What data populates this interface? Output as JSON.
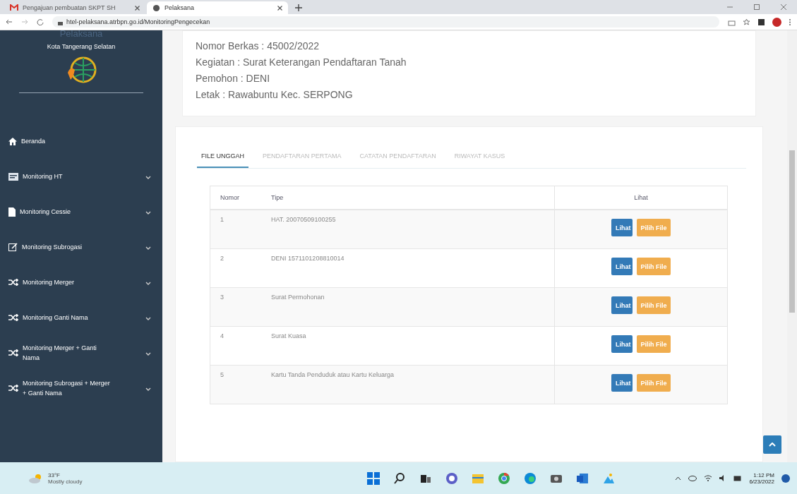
{
  "browser": {
    "tabs": [
      {
        "title": "Pengajuan pembuatan SKPT SH",
        "selected": false
      },
      {
        "title": "Pelaksana",
        "selected": true
      }
    ],
    "url": "htel-pelaksana.atrbpn.go.id/MonitoringPengecekan"
  },
  "sidebar": {
    "title": "Pelaksana",
    "subtitle": "Kota Tangerang Selatan",
    "items": [
      {
        "label": "Beranda",
        "kind": "home",
        "expandable": false
      },
      {
        "label": "Monitoring HT",
        "kind": "card",
        "expandable": true
      },
      {
        "label": "Monitoring Cessie",
        "kind": "file",
        "expandable": true
      },
      {
        "label": "Monitoring Subrogasi",
        "kind": "edit",
        "expandable": true
      },
      {
        "label": "Monitoring Merger",
        "kind": "shuffle",
        "expandable": true
      },
      {
        "label": "Monitoring Ganti Nama",
        "kind": "shuffle",
        "expandable": true
      },
      {
        "label": "Monitoring Merger + Ganti Nama",
        "kind": "shuffle",
        "expandable": true
      },
      {
        "label": "Monitoring Subrogasi + Merger + Ganti Nama",
        "kind": "shuffle",
        "expandable": true
      }
    ]
  },
  "info": [
    "Nomor Berkas : 45002/2022",
    "Kegiatan : Surat Keterangan Pendaftaran Tanah",
    "Pemohon : DENI",
    "Letak : Rawabuntu Kec. SERPONG"
  ],
  "tabs": [
    {
      "label": "FILE UNGGAH",
      "selected": true
    },
    {
      "label": "PENDAFTARAN PERTAMA",
      "selected": false
    },
    {
      "label": "CATATAN PENDAFTARAN",
      "selected": false
    },
    {
      "label": "RIWAYAT KASUS",
      "selected": false
    }
  ],
  "table": {
    "columns": [
      "Nomor",
      "Tipe",
      "Lihat"
    ],
    "rows": [
      {
        "nomor": "1",
        "tipe": "HAT. 20070509100255",
        "view": "Lihat",
        "pick": "Pilih File"
      },
      {
        "nomor": "2",
        "tipe": "DENI 1571101208810014",
        "view": "Lihat",
        "pick": "Pilih File"
      },
      {
        "nomor": "3",
        "tipe": "Surat Permohonan",
        "view": "Lihat",
        "pick": "Pilih File"
      },
      {
        "nomor": "4",
        "tipe": "Surat Kuasa",
        "view": "Lihat",
        "pick": "Pilih File"
      },
      {
        "nomor": "5",
        "tipe": "Kartu Tanda Penduduk atau Kartu Keluarga",
        "view": "Lihat",
        "pick": "Pilih File"
      }
    ]
  },
  "taskbar": {
    "weather": "33°F",
    "weather_note": "Mostly cloudy",
    "time": "1:12 PM",
    "date": "6/23/2022"
  }
}
